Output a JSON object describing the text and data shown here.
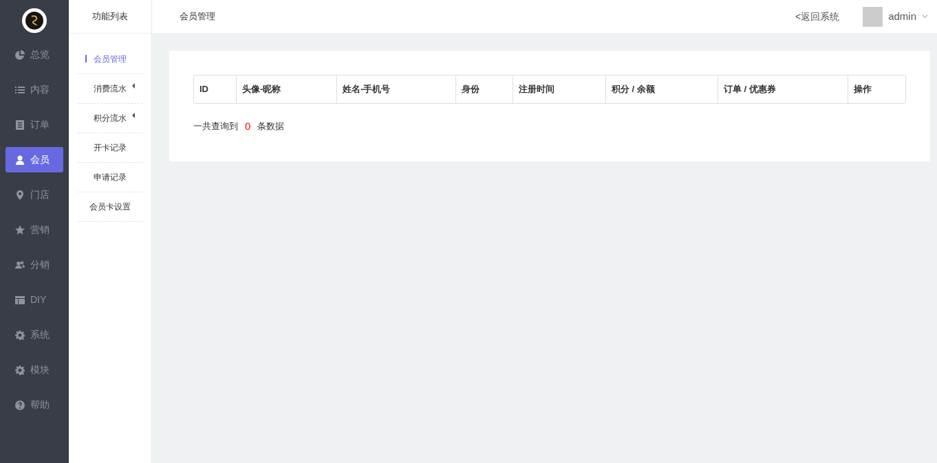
{
  "nav": [
    {
      "label": "总览",
      "kind": "pie",
      "selected": false
    },
    {
      "label": "内容",
      "kind": "list",
      "selected": false
    },
    {
      "label": "订单",
      "kind": "doc",
      "selected": false
    },
    {
      "label": "会员",
      "kind": "user",
      "selected": true
    },
    {
      "label": "门店",
      "kind": "pin",
      "selected": false
    },
    {
      "label": "营销",
      "kind": "star",
      "selected": false
    },
    {
      "label": "分销",
      "kind": "users",
      "selected": false
    },
    {
      "label": "DIY",
      "kind": "layout",
      "selected": false
    },
    {
      "label": "系统",
      "kind": "gear",
      "selected": false
    },
    {
      "label": "模块",
      "kind": "gear",
      "selected": false
    },
    {
      "label": "帮助",
      "kind": "help",
      "selected": false
    }
  ],
  "submenu": {
    "title": "功能列表",
    "items": [
      {
        "label": "会员管理",
        "selected": true,
        "has_children": false
      },
      {
        "label": "消费流水",
        "selected": false,
        "has_children": true
      },
      {
        "label": "积分流水",
        "selected": false,
        "has_children": true
      },
      {
        "label": "开卡记录",
        "selected": false,
        "has_children": false
      },
      {
        "label": "申请记录",
        "selected": false,
        "has_children": false
      },
      {
        "label": "会员卡设置",
        "selected": false,
        "has_children": false
      }
    ]
  },
  "header": {
    "title": "会员管理",
    "back_link": "<返回系统",
    "user": "admin"
  },
  "table": {
    "columns": [
      "ID",
      "头像-昵称",
      "姓名-手机号",
      "身份",
      "注册时间",
      "积分 / 余额",
      "订单 / 优惠券",
      "操作"
    ]
  },
  "summary": {
    "prefix": "一共查询到",
    "count": "0",
    "suffix": "条数据"
  }
}
